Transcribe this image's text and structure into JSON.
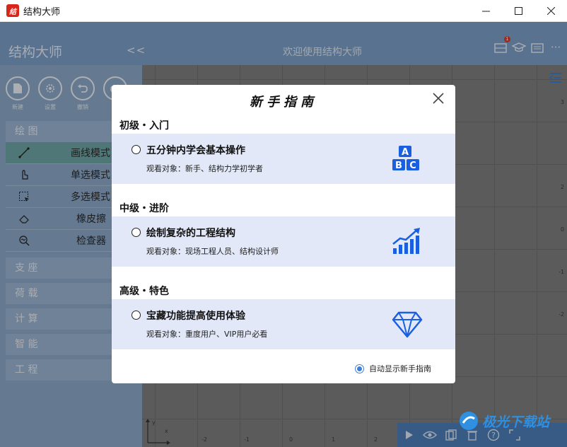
{
  "window": {
    "title": "结构大师",
    "logo_text": "结"
  },
  "header": {
    "app_name": "结构大师",
    "collapse_label": "<<",
    "welcome": "欢迎使用结构大师",
    "badge_count": "1",
    "menu_label": "···"
  },
  "sidebar": {
    "tools": [
      {
        "label": "新建",
        "icon": "file-icon"
      },
      {
        "label": "设置",
        "icon": "gear-icon"
      },
      {
        "label": "撤销",
        "icon": "undo-icon"
      },
      {
        "label": "",
        "icon": "redo-icon"
      }
    ],
    "sections": {
      "draw": "绘 图",
      "support": "支 座",
      "load": "荷 载",
      "calc": "计 算",
      "smart": "智 能",
      "engineering": "工 程"
    },
    "modes": [
      {
        "label": "画线模式",
        "icon": "line-icon",
        "active": true
      },
      {
        "label": "单选模式",
        "icon": "pointer-icon",
        "active": false
      },
      {
        "label": "多选模式",
        "icon": "marquee-icon",
        "active": false
      },
      {
        "label": "橡皮擦",
        "icon": "eraser-icon",
        "active": false
      },
      {
        "label": "检查器",
        "icon": "inspector-icon",
        "active": false
      }
    ]
  },
  "canvas": {
    "y_ticks": [
      "3",
      "2",
      "1",
      "0",
      "-1",
      "-2"
    ],
    "x_ticks": [
      "-2",
      "-1",
      "0",
      "1",
      "2"
    ],
    "axis_labels": {
      "x": "x",
      "y": "y"
    }
  },
  "guide": {
    "title": "新手指南",
    "levels": [
      {
        "heading": "初级・入门",
        "card_title": "五分钟内学会基本操作",
        "card_sub": "观看对象：新手、结构力学初学者",
        "icon": "abc-blocks-icon",
        "letters": [
          "A",
          "B",
          "C"
        ]
      },
      {
        "heading": "中级・进阶",
        "card_title": "绘制复杂的工程结构",
        "card_sub": "观看对象：现场工程人员、结构设计师",
        "icon": "growth-chart-icon"
      },
      {
        "heading": "高级・特色",
        "card_title": "宝藏功能提高使用体验",
        "card_sub": "观看对象：重度用户、VIP用户必看",
        "icon": "diamond-icon"
      }
    ],
    "auto_show_label": "自动显示新手指南"
  },
  "watermark": {
    "text": "极光下载站"
  },
  "colors": {
    "accent": "#3b7fd8",
    "icon_blue": "#1a5fe0",
    "header": "#7a9fc8"
  }
}
